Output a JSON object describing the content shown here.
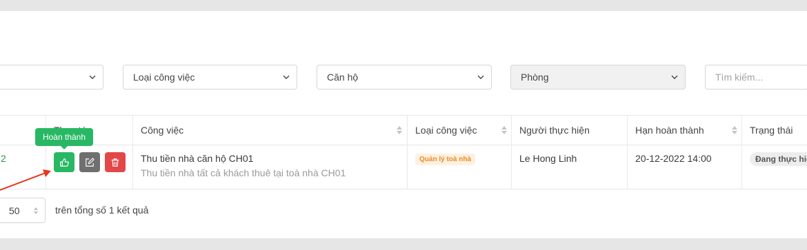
{
  "filters": {
    "type_select": "Loại công việc",
    "apartment_select": "Căn hộ",
    "room_select": "Phòng",
    "search_placeholder": "Tìm kiếm..."
  },
  "table": {
    "headers": {
      "actions": "Thao tác",
      "task": "Công việc",
      "type": "Loại công việc",
      "assignee": "Người thực hiện",
      "deadline": "Hạn hoàn thành",
      "status": "Trạng thái"
    },
    "rows": [
      {
        "index": "2",
        "task_title": "Thu tiền nhà căn hộ CH01",
        "task_desc": "Thu tiền nhà tất cả khách thuê tại toà nhà CH01",
        "type_badge": "Quản lý toà nhà",
        "assignee": "Le Hong Linh",
        "deadline": "20-12-2022 14:00",
        "status": "Đang thực hiện"
      }
    ]
  },
  "tooltip": "Hoàn thành",
  "icons": {
    "complete": "thumbs-up-icon",
    "edit": "edit-icon",
    "delete": "trash-icon"
  },
  "colors": {
    "green": "#28b864",
    "gray": "#6f6f6f",
    "red": "#e2474a",
    "arrow": "#e8361f",
    "badge_orange_text": "#f08a1c"
  },
  "pagination": {
    "page_size": "50",
    "total_text": "trên tổng số 1 kết quả"
  }
}
